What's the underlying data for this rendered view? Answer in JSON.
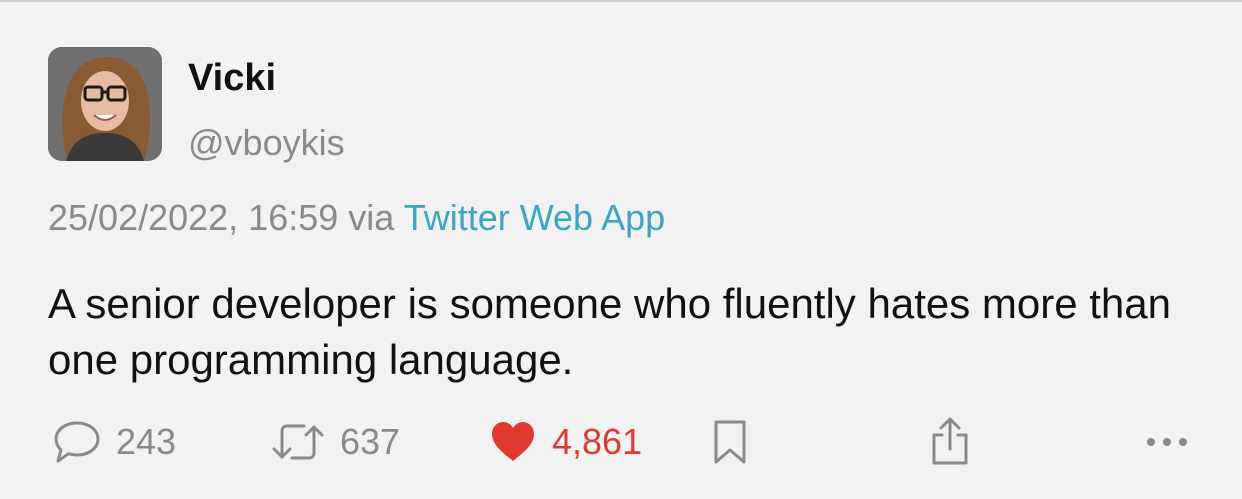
{
  "tweet": {
    "author": {
      "display_name": "Vicki",
      "handle": "@vboykis"
    },
    "timestamp": "25/02/2022, 16:59",
    "via_label": "via",
    "source": "Twitter Web App",
    "text": "A senior developer is someone who fluently hates more than one programming language."
  },
  "actions": {
    "replies": "243",
    "retweets": "637",
    "likes": "4,861",
    "liked": true
  },
  "icons": {
    "reply": "speech-bubble-icon",
    "retweet": "retweet-icon",
    "like": "heart-icon",
    "bookmark": "bookmark-icon",
    "share": "share-icon",
    "more": "ellipsis-icon"
  },
  "colors": {
    "background": "#f2f2f2",
    "link": "#3ba6c3",
    "like_active": "#e0392f",
    "secondary_text": "#8a8a8a"
  }
}
